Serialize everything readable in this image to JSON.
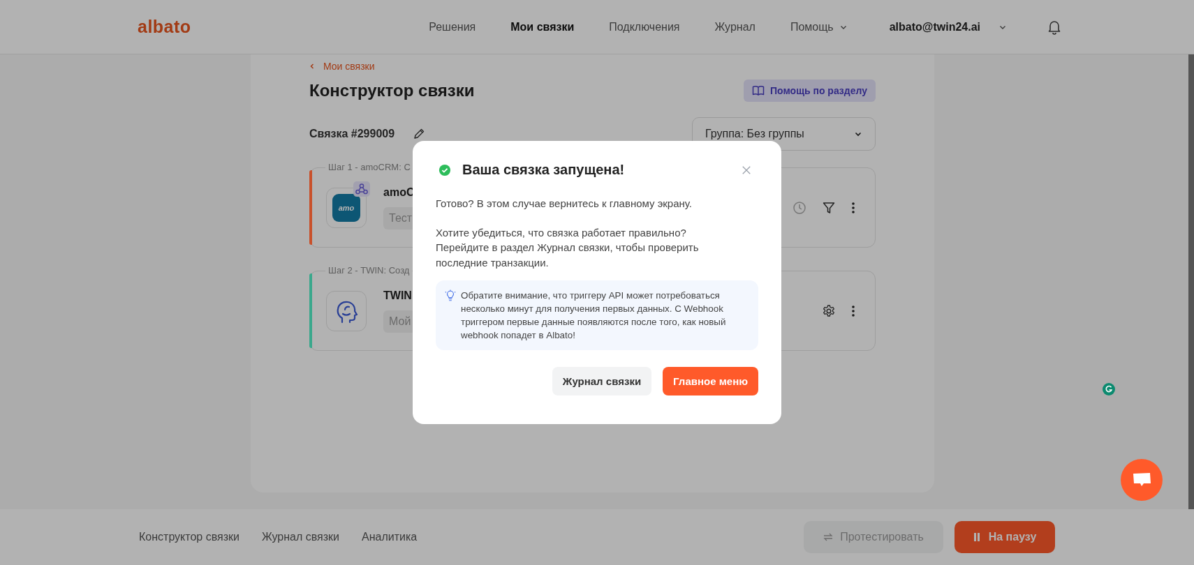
{
  "header": {
    "logo": "albato",
    "nav": [
      {
        "label": "Решения",
        "selected": false
      },
      {
        "label": "Мои связки",
        "selected": true
      },
      {
        "label": "Подключения",
        "selected": false
      },
      {
        "label": "Журнал",
        "selected": false
      },
      {
        "label": "Помощь",
        "selected": false,
        "dropdown": true
      }
    ],
    "account": "albato@twin24.ai"
  },
  "breadcrumb": "Мои связки",
  "title": "Конструктор связки",
  "help_button": "Помощь по разделу",
  "bundle_name": "Связка #299009",
  "group_select": "Группа: Без группы",
  "steps": [
    {
      "kind": "trigger",
      "legend": "Шаг 1 - amoCRM: С",
      "color": "#c9502a",
      "icon_label": "amo",
      "app": "amoC",
      "placeholder": "Тест"
    },
    {
      "kind": "action",
      "legend": "Шаг 2 - TWIN: Созд",
      "color": "#3aa88c",
      "app": "TWIN",
      "placeholder": "Мой"
    }
  ],
  "modal": {
    "title": "Ваша связка запущена!",
    "paragraphs": [
      [
        "Готово? В этом случае вернитесь к главному экрану."
      ],
      [
        "Хотите убедиться, что связка работает правильно?",
        "Перейдите в раздел Журнал связки, чтобы проверить последние транзакции."
      ]
    ],
    "note": "Обратите внимание, что триггеру API может потребоваться несколько минут для получения первых данных. С Webhook триггером первые данные появляются после того, как новый webhook попадет в Albato!",
    "buttons": [
      {
        "kind": "secondary",
        "label": "Журнал связки"
      },
      {
        "kind": "primary",
        "label": "Главное меню"
      }
    ]
  },
  "bottom_bar": {
    "tabs": [
      {
        "label": "Конструктор связки",
        "selected": false
      },
      {
        "label": "Журнал связки",
        "selected": false
      },
      {
        "label": "Аналитика",
        "selected": false
      }
    ],
    "test_button": {
      "label": "Протестировать",
      "disabled": true
    },
    "pause_button": "На паузу"
  }
}
